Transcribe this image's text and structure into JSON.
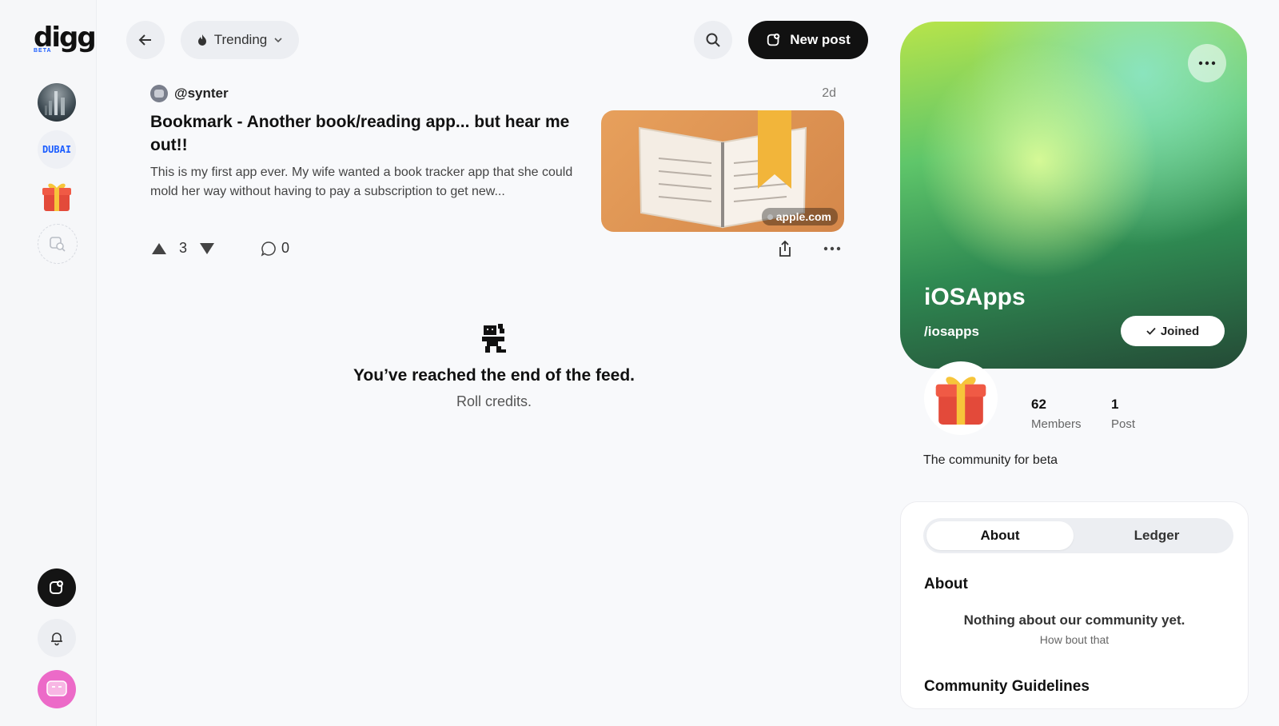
{
  "brand": {
    "logo_text": "digg",
    "badge": "BETA"
  },
  "rail": {
    "communities": [
      {
        "name": "city-community"
      },
      {
        "name": "dubai-community",
        "label": "DUBAI"
      },
      {
        "name": "gift-community"
      }
    ]
  },
  "topbar": {
    "feed_filter": "Trending",
    "new_post": "New post"
  },
  "post": {
    "author": "@synter",
    "time": "2d",
    "title": "Bookmark - Another book/reading app... but hear me out!!",
    "excerpt": "This is my first app ever. My wife wanted a book tracker app that she could mold her way without having to pay a subscription to get new...",
    "source": "apple.com",
    "score": "3",
    "comments": "0"
  },
  "feed_end": {
    "heading": "You’ve reached the end of the feed.",
    "sub": "Roll credits."
  },
  "community": {
    "name": "iOSApps",
    "slug": "/iosapps",
    "joined_label": "Joined",
    "members_count": "62",
    "members_label": "Members",
    "posts_count": "1",
    "posts_label": "Post",
    "description": "The community for beta",
    "colors": {
      "hero_top": "#b8e44a",
      "hero_bottom": "#244a36"
    }
  },
  "about_card": {
    "tabs": [
      "About",
      "Ledger"
    ],
    "active_tab": "About",
    "about_heading": "About",
    "empty_heading": "Nothing about our community yet.",
    "empty_sub": "How bout that",
    "guidelines_heading": "Community Guidelines"
  }
}
